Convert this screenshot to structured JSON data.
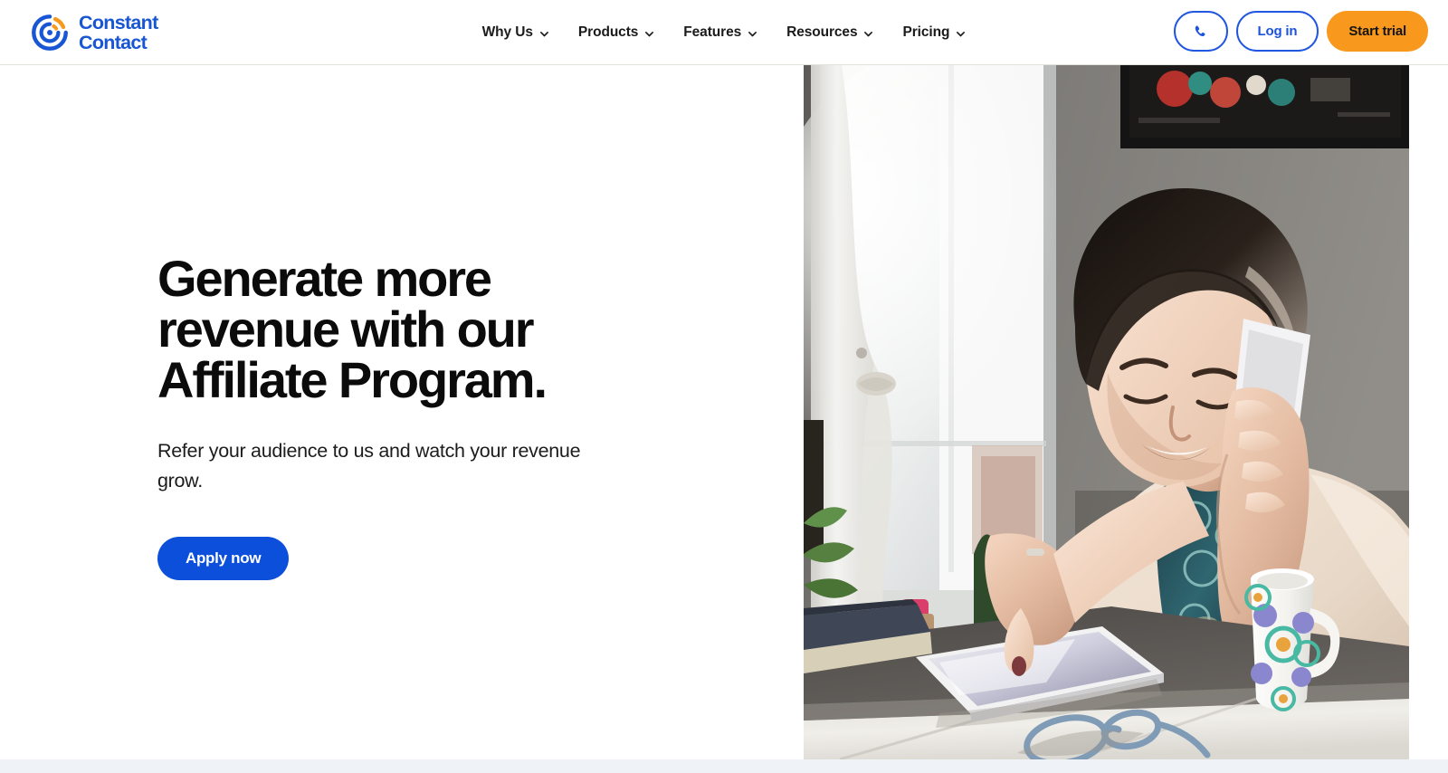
{
  "brand": {
    "logo_icon": "constant-contact-circle-logo",
    "name_line1": "Constant",
    "name_line2": "Contact",
    "blue": "#1856d4",
    "orange": "#f8981d"
  },
  "header": {
    "nav": [
      {
        "label": "Why Us",
        "icon": "chevron-down-icon"
      },
      {
        "label": "Products",
        "icon": "chevron-down-icon"
      },
      {
        "label": "Features",
        "icon": "chevron-down-icon"
      },
      {
        "label": "Resources",
        "icon": "chevron-down-icon"
      },
      {
        "label": "Pricing",
        "icon": "chevron-down-icon"
      }
    ],
    "phone_button": {
      "icon": "phone-icon",
      "label": ""
    },
    "login_button": {
      "label": "Log in"
    },
    "trial_button": {
      "label": "Start trial"
    }
  },
  "hero": {
    "title": "Generate more revenue with our Affiliate Program.",
    "subtitle": "Refer your audience to us and watch your revenue grow.",
    "cta_label": "Apply now",
    "image_alt": "woman-on-phone-using-tablet-at-desk"
  },
  "colors": {
    "primary_blue": "#0b4fdb",
    "accent_orange": "#f8981d",
    "text_dark": "#0b0b0b",
    "footer_strip": "#eff3f7",
    "header_border": "#e3e1dc"
  }
}
